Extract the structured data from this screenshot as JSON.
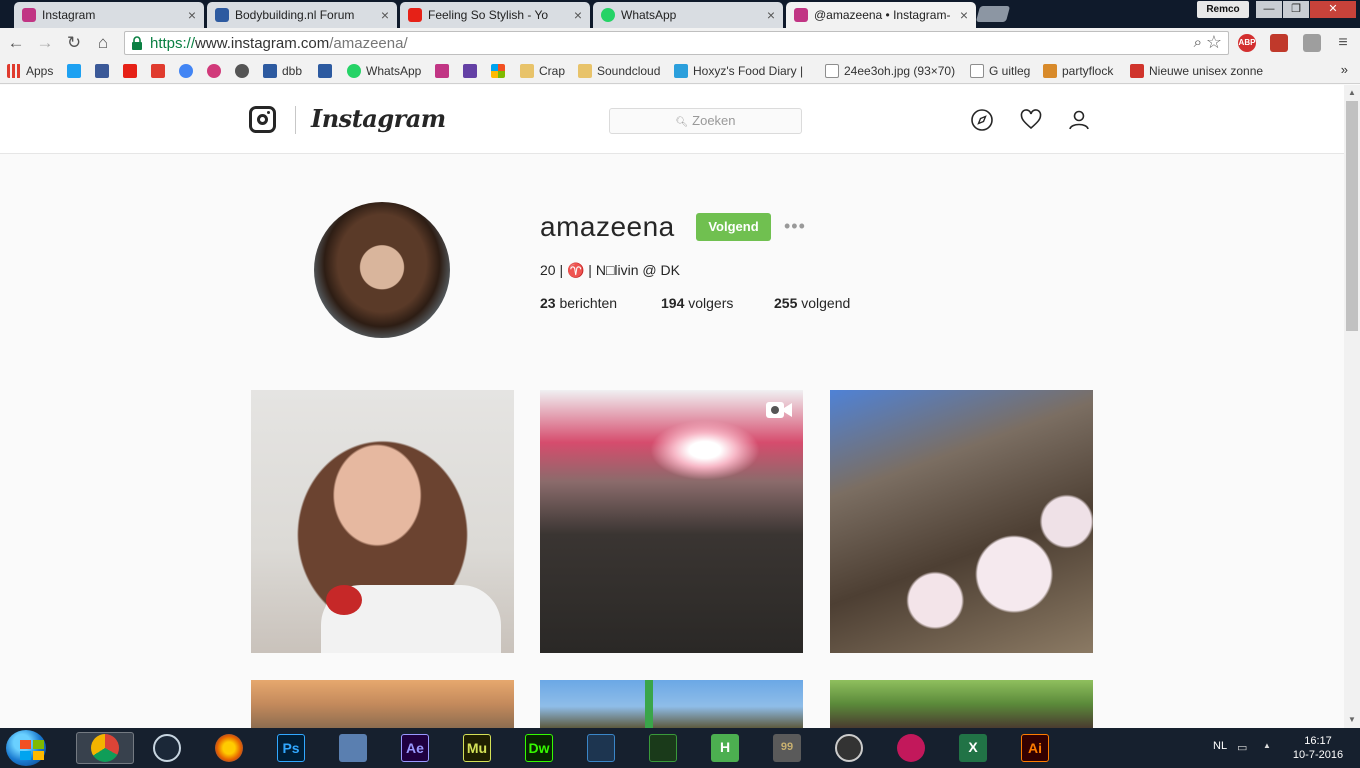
{
  "browser": {
    "tabs": [
      {
        "title": "Instagram",
        "icon": "instagram-icon",
        "color": "#c13584"
      },
      {
        "title": "Bodybuilding.nl Forum",
        "icon": "bodybuilding-icon",
        "color": "#2d5aa0"
      },
      {
        "title": "Feeling So Stylish - Yo",
        "icon": "youtube-icon",
        "color": "#e62117"
      },
      {
        "title": "WhatsApp",
        "icon": "whatsapp-icon",
        "color": "#25d366"
      },
      {
        "title": "@amazeena • Instagram-",
        "icon": "instagram-icon",
        "color": "#c13584",
        "active": true
      }
    ],
    "profile_name": "Remco",
    "window_controls": {
      "minimize": "—",
      "maximize": "❐",
      "close": "✕"
    },
    "url": {
      "scheme": "https://",
      "host": "www.instagram.com",
      "path": "/amazeena/"
    },
    "bookmarks": [
      {
        "label": "Apps",
        "icon": "apps-grid-icon",
        "color": "#e03b2e"
      },
      {
        "label": "",
        "icon": "twitter-icon",
        "color": "#1da1f2"
      },
      {
        "label": "",
        "icon": "facebook-icon",
        "color": "#3b5998"
      },
      {
        "label": "",
        "icon": "youtube-icon",
        "color": "#e62117"
      },
      {
        "label": "",
        "icon": "dumpert-icon",
        "color": "#e03b2e"
      },
      {
        "label": "",
        "icon": "google-icon",
        "color": "#4285f4"
      },
      {
        "label": "",
        "icon": "spotify-like-icon",
        "color": "#d13a7a"
      },
      {
        "label": "",
        "icon": "bolt-icon",
        "color": "#555555"
      },
      {
        "label": "dbb",
        "icon": "bodybuilding-icon",
        "color": "#2d5aa0"
      },
      {
        "label": "",
        "icon": "bodybuilding-icon",
        "color": "#2d5aa0"
      },
      {
        "label": "WhatsApp",
        "icon": "whatsapp-icon",
        "color": "#25d366"
      },
      {
        "label": "",
        "icon": "instagram-icon",
        "color": "#c13584"
      },
      {
        "label": "",
        "icon": "twitch-icon",
        "color": "#6441a5"
      },
      {
        "label": "",
        "icon": "windows-icon",
        "color": "#f25022"
      },
      {
        "label": "Crap",
        "icon": "folder-icon",
        "color": "#e8c36a"
      },
      {
        "label": "Soundcloud",
        "icon": "folder-icon",
        "color": "#e8c36a"
      },
      {
        "label": "Hoxyz's Food Diary |",
        "icon": "x-icon",
        "color": "#2b9fdc"
      },
      {
        "label": "24ee3oh.jpg (93×70)",
        "icon": "image-icon",
        "color": "#8e8e8e"
      },
      {
        "label": "G uitleg",
        "icon": "doc-icon",
        "color": "#8e8e8e"
      },
      {
        "label": "partyflock",
        "icon": "partyflock-icon",
        "color": "#d88a2a"
      },
      {
        "label": "Nieuwe unisex zonne",
        "icon": "shop-icon",
        "color": "#d0342c"
      }
    ],
    "bookmarks_more": "»"
  },
  "instagram": {
    "wordmark": "Instagram",
    "search_placeholder": "Zoeken",
    "profile": {
      "username": "amazeena",
      "follow_label": "Volgend",
      "bio": "20 | ♈ | N□livin @ DK",
      "posts_count": "23",
      "posts_label": "berichten",
      "followers_count": "194",
      "followers_label": "volgers",
      "following_count": "255",
      "following_label": "volgend"
    },
    "posts": [
      {
        "kind": "photo",
        "subject": "selfie"
      },
      {
        "kind": "video",
        "subject": "concert crowd"
      },
      {
        "kind": "photo",
        "subject": "magnolia blossoms"
      },
      {
        "kind": "photo",
        "subject": "city buildings"
      },
      {
        "kind": "photo",
        "subject": "festival sky"
      },
      {
        "kind": "photo",
        "subject": "park crowd"
      }
    ],
    "accent_color": "#70c050"
  },
  "taskbar": {
    "apps": [
      {
        "name": "chrome-icon",
        "label": "",
        "color": "#4285f4",
        "active": true
      },
      {
        "name": "steam-icon",
        "label": "",
        "color": "#1b2838"
      },
      {
        "name": "firefox-icon",
        "label": "",
        "color": "#e66000"
      },
      {
        "name": "photoshop-icon",
        "label": "Ps",
        "color": "#31a8ff"
      },
      {
        "name": "keyboard-icon",
        "label": "",
        "color": "#5a7fb0"
      },
      {
        "name": "after-effects-icon",
        "label": "Ae",
        "color": "#9999ff"
      },
      {
        "name": "muse-icon",
        "label": "Mu",
        "color": "#d4e157"
      },
      {
        "name": "dreamweaver-icon",
        "label": "Dw",
        "color": "#35fa00"
      },
      {
        "name": "film-icon",
        "label": "",
        "color": "#3a86c8"
      },
      {
        "name": "4game-icon",
        "label": "",
        "color": "#3a9a3a"
      },
      {
        "name": "h-icon",
        "label": "H",
        "color": "#4caf50"
      },
      {
        "name": "screen-icon",
        "label": "99",
        "color": "#c8b070"
      },
      {
        "name": "rockstar-icon",
        "label": "",
        "color": "#cccccc"
      },
      {
        "name": "osu-icon",
        "label": "",
        "color": "#c2185b"
      },
      {
        "name": "excel-icon",
        "label": "X",
        "color": "#217346"
      },
      {
        "name": "illustrator-icon",
        "label": "Ai",
        "color": "#ff7c00"
      }
    ],
    "language": "NL",
    "time": "16:17",
    "date": "10-7-2016"
  }
}
